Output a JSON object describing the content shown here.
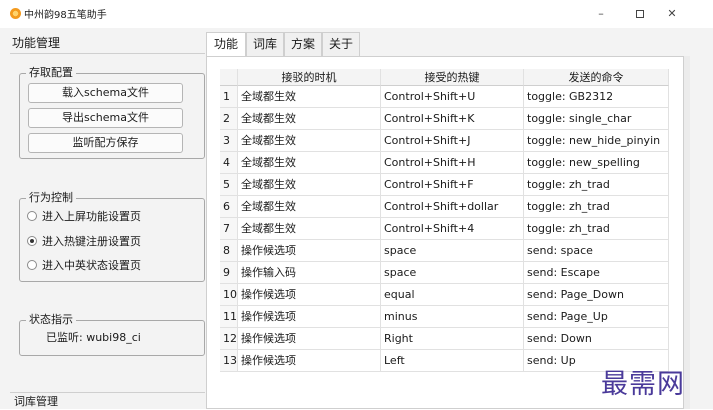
{
  "window": {
    "title": "中州韵98五笔助手",
    "minimize_glyph": "–",
    "close_glyph": "✕"
  },
  "left_pane": {
    "title": "功能管理",
    "schema_group": {
      "legend": "存取配置",
      "buttons": [
        "载入schema文件",
        "导出schema文件",
        "监听配方保存"
      ]
    },
    "behavior_group": {
      "legend": "行为控制",
      "options": [
        {
          "label": "进入上屏功能设置页",
          "selected": false
        },
        {
          "label": "进入热键注册设置页",
          "selected": true
        },
        {
          "label": "进入中英状态设置页",
          "selected": false
        }
      ]
    },
    "status_group": {
      "legend": "状态指示",
      "text": "已监听: wubi98_ci"
    },
    "bottom_title": "词库管理"
  },
  "tabs": [
    "功能",
    "词库",
    "方案",
    "关于"
  ],
  "active_tab": "功能",
  "table": {
    "columns": [
      "接驳的时机",
      "接受的热键",
      "发送的命令"
    ],
    "rows": [
      {
        "n": "1",
        "timing": "全域都生效",
        "hotkey": "Control+Shift+U",
        "command": "toggle: GB2312"
      },
      {
        "n": "2",
        "timing": "全域都生效",
        "hotkey": "Control+Shift+K",
        "command": "toggle: single_char"
      },
      {
        "n": "3",
        "timing": "全域都生效",
        "hotkey": "Control+Shift+J",
        "command": "toggle: new_hide_pinyin"
      },
      {
        "n": "4",
        "timing": "全域都生效",
        "hotkey": "Control+Shift+H",
        "command": "toggle: new_spelling"
      },
      {
        "n": "5",
        "timing": "全域都生效",
        "hotkey": "Control+Shift+F",
        "command": "toggle: zh_trad"
      },
      {
        "n": "6",
        "timing": "全域都生效",
        "hotkey": "Control+Shift+dollar",
        "command": "toggle: zh_trad"
      },
      {
        "n": "7",
        "timing": "全域都生效",
        "hotkey": "Control+Shift+4",
        "command": "toggle: zh_trad"
      },
      {
        "n": "8",
        "timing": "操作候选项",
        "hotkey": "space",
        "command": "send: space"
      },
      {
        "n": "9",
        "timing": "操作输入码",
        "hotkey": "space",
        "command": "send: Escape"
      },
      {
        "n": "10",
        "timing": "操作候选项",
        "hotkey": "equal",
        "command": "send: Page_Down"
      },
      {
        "n": "11",
        "timing": "操作候选项",
        "hotkey": "minus",
        "command": "send: Page_Up"
      },
      {
        "n": "12",
        "timing": "操作候选项",
        "hotkey": "Right",
        "command": "send: Down"
      },
      {
        "n": "13",
        "timing": "操作候选项",
        "hotkey": "Left",
        "command": "send: Up"
      }
    ]
  },
  "watermark": "最需网",
  "colors": {
    "watermark": "#4a3a9a",
    "accent_icon": "#f39a1e"
  }
}
